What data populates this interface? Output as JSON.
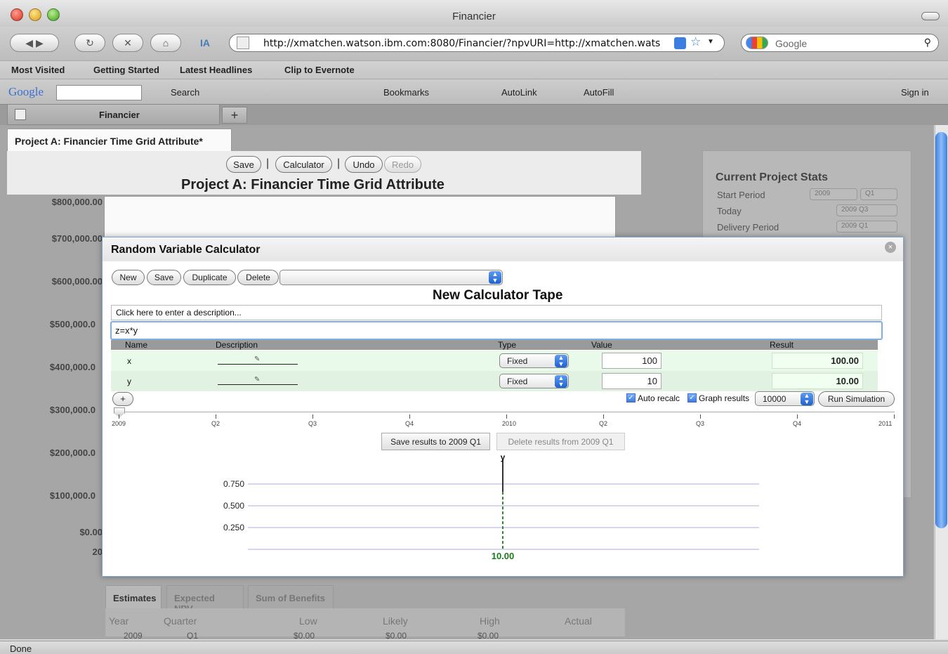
{
  "browser": {
    "window_title": "Financier",
    "url": "http://xmatchen.watson.ibm.com:8080/Financier/?npvURI=http://xmatchen.wats",
    "search_placeholder": "Google",
    "bookmarks": [
      "Most Visited",
      "Getting Started",
      "Latest Headlines",
      "Clip to Evernote"
    ],
    "google_toolbar": {
      "search_label": "Search",
      "bookmarks_label": "Bookmarks",
      "autolink_label": "AutoLink",
      "autofill_label": "AutoFill",
      "signin_label": "Sign in"
    },
    "tab_label": "Financier",
    "status": "Done"
  },
  "app": {
    "page_tab": "Project A: Financier Time Grid Attribute*",
    "toolbar": {
      "save": "Save",
      "calculator": "Calculator",
      "undo": "Undo",
      "redo": "Redo",
      "sep": "|"
    },
    "project_title": "Project A: Financier Time Grid Attribute",
    "y_axis_labels": [
      "$800,000.00",
      "$700,000.00",
      "$600,000.00",
      "$500,000.0",
      "$400,000.0",
      "$300,000.0",
      "$200,000.0",
      "$100,000.0",
      "$0.00",
      "20"
    ],
    "stats": {
      "title": "Current Project Stats",
      "start_label": "Start Period",
      "start_year": "2009",
      "start_q": "Q1",
      "today_label": "Today",
      "today_value": "2009 Q3",
      "delivery_label": "Delivery Period",
      "delivery_value": "2009 Q1"
    },
    "bottom_tabs": [
      "Estimates",
      "Expected NPV",
      "Sum of Benefits"
    ],
    "grid_headers": [
      "Year",
      "Quarter",
      "Low",
      "Likely",
      "High",
      "Actual"
    ],
    "grid_row": [
      "2009",
      "Q1",
      "$0.00",
      "$0.00",
      "$0.00"
    ]
  },
  "calculator": {
    "title": "Random Variable Calculator",
    "close": "×",
    "buttons": {
      "new": "New",
      "save": "Save",
      "duplicate": "Duplicate",
      "delete": "Delete"
    },
    "tape_title": "New Calculator Tape",
    "description_placeholder": "Click here to enter a description...",
    "formula": "z=x*y",
    "columns": {
      "name": "Name",
      "description": "Description",
      "type": "Type",
      "value": "Value",
      "result": "Result"
    },
    "variables": [
      {
        "name": "x",
        "type": "Fixed",
        "value": "100",
        "result": "100.00"
      },
      {
        "name": "y",
        "type": "Fixed",
        "value": "10",
        "result": "10.00"
      }
    ],
    "add_button": "+",
    "auto_recalc": "Auto recalc",
    "graph_results": "Graph results",
    "iterations": "10000",
    "run": "Run Simulation",
    "timeline_ticks": [
      "2009",
      "Q2",
      "Q3",
      "Q4",
      "2010",
      "Q2",
      "Q3",
      "Q4",
      "2011"
    ],
    "save_results": "Save results to 2009 Q1",
    "delete_results": "Delete results from 2009 Q1"
  },
  "chart_data": {
    "type": "line",
    "title": "y",
    "y_ticks": [
      "0.750",
      "0.500",
      "0.250"
    ],
    "ylim": [
      0,
      1
    ],
    "series": [
      {
        "x": [
          10.0
        ],
        "values": [
          1.0
        ]
      }
    ],
    "marker_label": "10.00",
    "grid": true
  }
}
